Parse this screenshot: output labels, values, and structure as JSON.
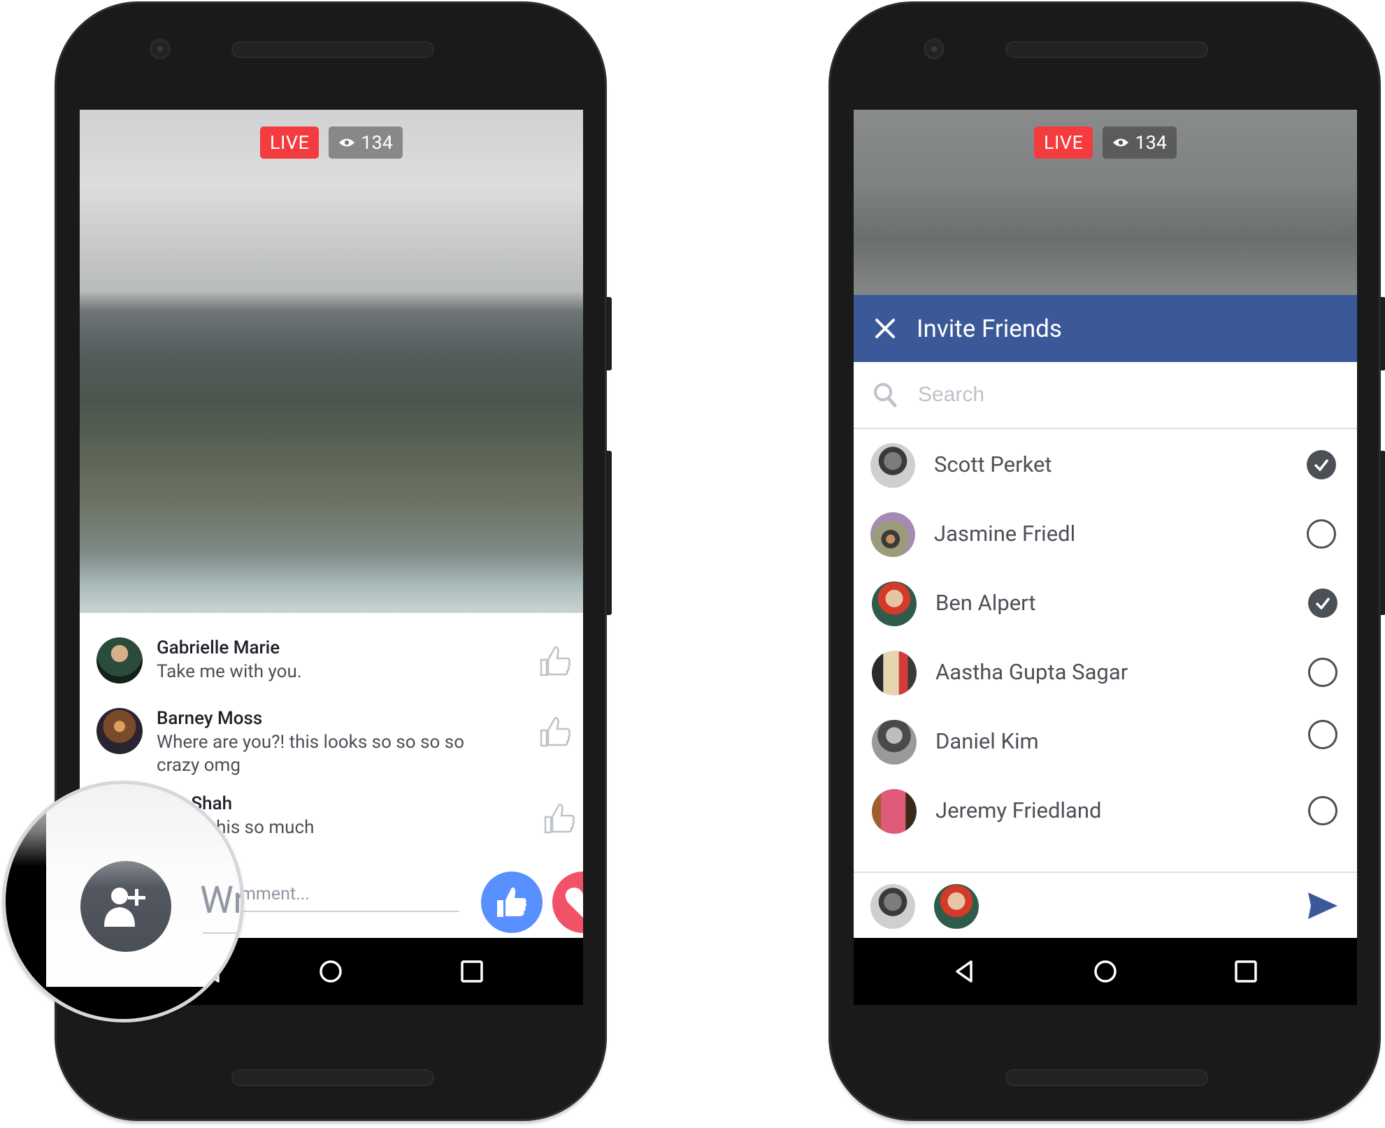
{
  "left_phone": {
    "live_badge": "LIVE",
    "viewer_count": "134",
    "viewer_icon": "eye-icon",
    "comments": [
      {
        "name": "Gabrielle Marie",
        "text": "Take me with you.",
        "avatar": "avatar-gabrielle"
      },
      {
        "name": "Barney Moss",
        "text": "Where are you?! this looks so so so so crazy omg",
        "avatar": "avatar-barney"
      },
      {
        "name": "e Shah",
        "text": "ve this so much",
        "avatar": "avatar-hidden"
      }
    ],
    "comment_input_placeholder": "mment...",
    "magnified_input_text": "Wr",
    "add_friend_icon": "add-friend-icon",
    "reactions": [
      "like",
      "love"
    ]
  },
  "right_phone": {
    "live_badge": "LIVE",
    "viewer_count": "134",
    "header_title": "Invite Friends",
    "search_placeholder": "Search",
    "friends": [
      {
        "name": "Scott Perket",
        "selected": true
      },
      {
        "name": "Jasmine Friedl",
        "selected": false
      },
      {
        "name": "Ben Alpert",
        "selected": true
      },
      {
        "name": "Aastha Gupta Sagar",
        "selected": false
      },
      {
        "name": "Daniel Kim",
        "selected": false
      },
      {
        "name": "Jeremy Friedland",
        "selected": false
      }
    ],
    "selected_friends": [
      "Scott Perket",
      "Ben Alpert"
    ]
  },
  "colors": {
    "live_red": "#f43b3e",
    "facebook_blue": "#3b5998",
    "like_blue": "#5890ff",
    "love_red": "#f25268",
    "text_dark": "#4b4f56"
  }
}
